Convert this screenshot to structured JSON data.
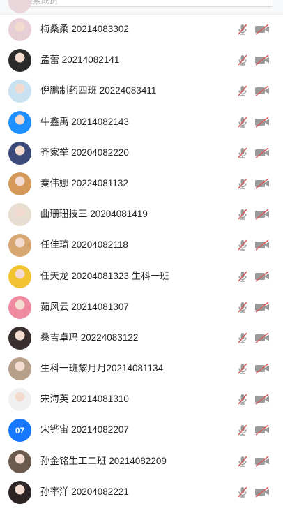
{
  "search": {
    "placeholder": "搜索成员"
  },
  "participants": [
    {
      "name": "梅桑柔 20214083302",
      "avatar_color": "#e8cfd6",
      "avatar_icon": "girl-photo-icon"
    },
    {
      "name": "孟蕾 20214082141",
      "avatar_color": "#2a2a2a",
      "avatar_icon": "girl-photo-icon"
    },
    {
      "name": "倪鹏制药四班 20224083411",
      "avatar_color": "#c9e2f2",
      "avatar_icon": "cartoon-whale-icon"
    },
    {
      "name": "牛鑫禹 20214082143",
      "avatar_color": "#1e90ff",
      "avatar_icon": "qq-penguin-icon"
    },
    {
      "name": "齐家举 20204082220",
      "avatar_color": "#3b4a7a",
      "avatar_icon": "anime-photo-icon"
    },
    {
      "name": "秦伟娜 20224081132",
      "avatar_color": "#d59a5a",
      "avatar_icon": "cat-photo-icon"
    },
    {
      "name": "曲珊珊技三 20204081419",
      "avatar_color": "#e7ddd0",
      "avatar_icon": "dog-photo-icon"
    },
    {
      "name": "任佳琦 20204082118",
      "avatar_color": "#d8a670",
      "avatar_icon": "dog-photo-icon"
    },
    {
      "name": "任天龙 20204081323 生科一班",
      "avatar_color": "#f1c232",
      "avatar_icon": "anime-luffy-icon"
    },
    {
      "name": "茹风云 20214081307",
      "avatar_color": "#f08aa0",
      "avatar_icon": "pig-heart-icon"
    },
    {
      "name": "桑吉卓玛 20224083122",
      "avatar_color": "#3a2f2f",
      "avatar_icon": "girl-photo-icon"
    },
    {
      "name": "生科一班黎月月20214081134",
      "avatar_color": "#b7a08a",
      "avatar_icon": "group-photo-icon"
    },
    {
      "name": "宋海英 20214081310",
      "avatar_color": "#f0f0f0",
      "avatar_icon": "girl-photo-icon"
    },
    {
      "name": "宋铧宙 20214082207",
      "avatar_color": "#1677ff",
      "avatar_icon": "initials-avatar",
      "avatar_text": "07"
    },
    {
      "name": "孙金铭生工二班 20214082209",
      "avatar_color": "#6b5a4e",
      "avatar_icon": "girl-photo-icon"
    },
    {
      "name": "孙率洋 20204082221",
      "avatar_color": "#2c2424",
      "avatar_icon": "girl-photo-icon"
    }
  ],
  "status": {
    "mic_muted_color": "#d95a5a",
    "cam_off_color": "#d95a5a",
    "icon_gray": "#9b9b9b"
  }
}
